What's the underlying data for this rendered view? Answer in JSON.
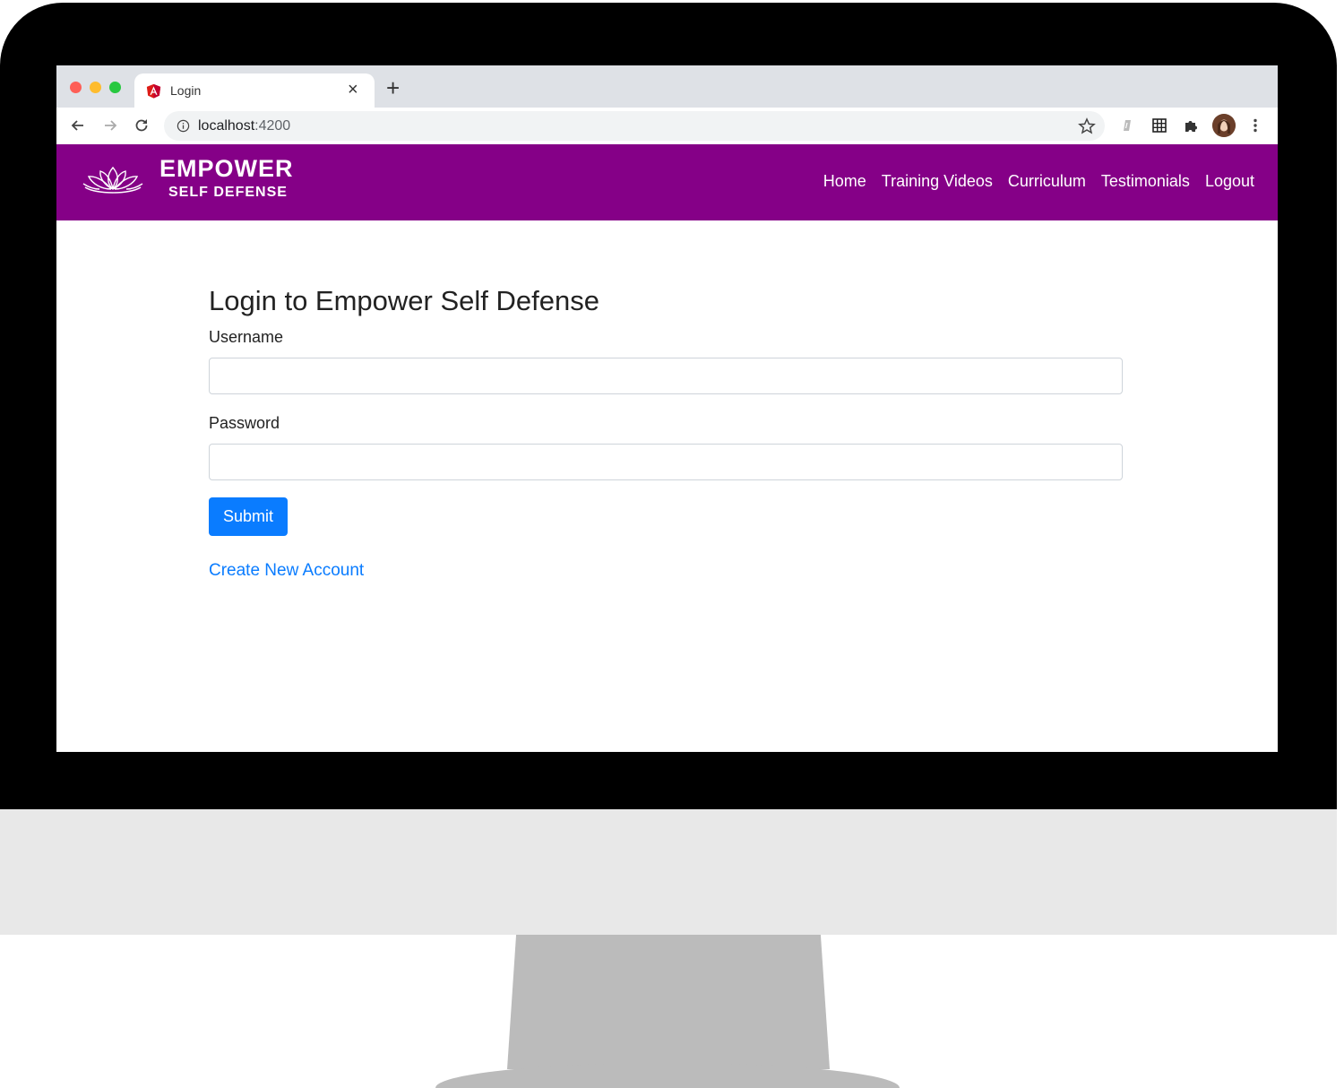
{
  "browser": {
    "tab_title": "Login",
    "new_tab_symbol": "+",
    "close_symbol": "×",
    "url_host": "localhost",
    "url_port": ":4200"
  },
  "site": {
    "brand_main": "EMPOWER",
    "brand_sub": "SELF DEFENSE",
    "nav": [
      "Home",
      "Training Videos",
      "Curriculum",
      "Testimonials",
      "Logout"
    ],
    "nav_color": "#850087"
  },
  "login": {
    "title": "Login to Empower Self Defense",
    "username_label": "Username",
    "username_value": "",
    "password_label": "Password",
    "password_value": "",
    "submit_label": "Submit",
    "create_account_label": "Create New Account",
    "accent_color": "#0a7cff"
  },
  "icons": [
    "angular-favicon-icon",
    "back-arrow-icon",
    "forward-arrow-icon",
    "reload-icon",
    "info-icon",
    "star-icon",
    "extension-icon",
    "grid-icon",
    "puzzle-icon",
    "menu-dots-icon",
    "lotus-icon"
  ]
}
